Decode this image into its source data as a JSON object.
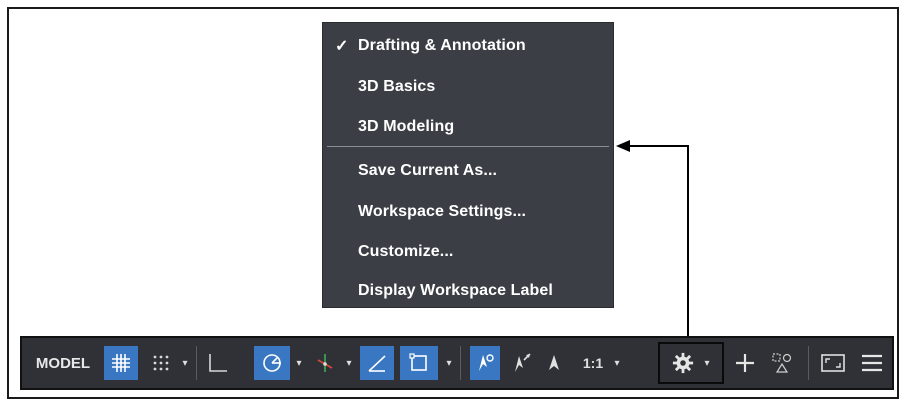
{
  "workspace_menu": {
    "items": [
      {
        "label": "Drafting & Annotation",
        "checked": true,
        "check_glyph": "✓"
      },
      {
        "label": "3D Basics",
        "checked": false
      },
      {
        "label": "3D Modeling",
        "checked": false
      },
      {
        "label": "Save Current As...",
        "checked": false
      },
      {
        "label": "Workspace Settings...",
        "checked": false
      },
      {
        "label": "Customize...",
        "checked": false
      },
      {
        "label": "Display Workspace Label",
        "checked": false
      }
    ]
  },
  "status_bar": {
    "model_label": "MODEL",
    "annotation_scale": "1:1",
    "dropdown_glyph": "▾",
    "icons": [
      "grid-icon",
      "snap-mode-icon",
      "ortho-icon",
      "polar-tracking-icon",
      "object-snap-tracking-icon",
      "dynamic-ucs-icon",
      "selection-cycling-icon",
      "annotation-visibility-icon",
      "auto-scale-icon",
      "annotation-scale-icon",
      "workspace-switching-gear-icon",
      "plus-icon",
      "isolate-objects-icon",
      "clean-screen-icon",
      "customization-menu-icon"
    ]
  },
  "colors": {
    "menu_bg": "#3b3e44",
    "statusbar_bg": "#2f3136",
    "active_blue": "#3a77c2",
    "text": "#ffffff"
  }
}
